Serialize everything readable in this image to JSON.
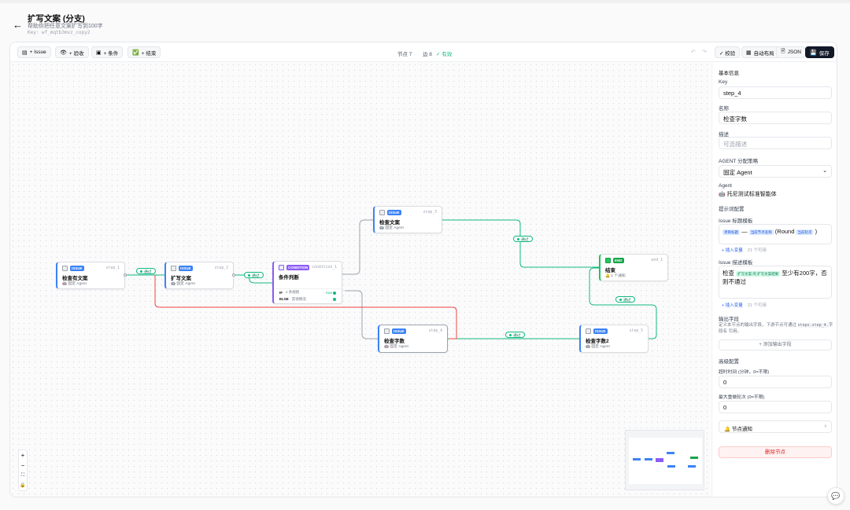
{
  "header": {
    "back_icon": "arrow-left-icon",
    "title": "扩写文案 (分支)",
    "subtitle": "帮助你把任意文案扩写到100字",
    "key_line": "Key: wf_mqtb3mvz_copy2"
  },
  "toolbar": {
    "add_issue": "+ Issue",
    "add_review": "+ 验收",
    "add_condition": "+ 条件",
    "add_end": "+ 结束",
    "node_count": "节点 7",
    "edge_count": "边 8",
    "valid": "✓ 有效",
    "validate": "✓ 校验",
    "auto_layout": "自动布局",
    "json": "JSON",
    "save": "保存"
  },
  "nodes": {
    "step1": {
      "badge": "ISSUE",
      "key": "step_1",
      "title": "检查有文案",
      "agent": "固定 Agent"
    },
    "step2": {
      "badge": "ISSUE",
      "key": "step_2",
      "title": "扩写文案",
      "agent": "固定 Agent"
    },
    "cond": {
      "badge": "CONDITION",
      "key": "condition_1",
      "title": "条件判断",
      "if_label": "IF",
      "if_text": "1 条规则",
      "if_val": "true",
      "else_label": "ELSE",
      "else_text": "其他情况"
    },
    "step3": {
      "badge": "ISSUE",
      "key": "step_3",
      "title": "检查文案",
      "agent": "固定 Agent"
    },
    "step4": {
      "badge": "ISSUE",
      "key": "step_4",
      "title": "检查字数",
      "agent": "固定 Agent"
    },
    "step5": {
      "badge": "ISSUE",
      "key": "step_5",
      "title": "检查字数2",
      "agent": "固定 Agent"
    },
    "end": {
      "badge": "END",
      "key": "end_1",
      "title": "结束",
      "sub": "1 个通知"
    }
  },
  "edge_label": "通过",
  "zoom": {
    "in": "+",
    "out": "−",
    "fit": "⛶",
    "lock": "🔒"
  },
  "panel": {
    "basic_info": "基本信息",
    "key_label": "Key",
    "key_value": "step_4",
    "name_label": "名称",
    "name_value": "检查字数",
    "desc_label": "描述",
    "desc_placeholder": "可选描述",
    "agent_strategy_label": "AGENT 分配策略",
    "agent_strategy_value": "固定 Agent",
    "agent_label": "Agent",
    "agent_value": "托尼测试标准智能体",
    "prompt_config": "提示词配置",
    "issue_title_tmpl_label": "Issue 标题模板",
    "chip_project_title": "项目标题",
    "title_sep": "—",
    "chip_node_name": "当前节点名称",
    "title_round_open": "(Round",
    "chip_round": "当前轮次",
    "title_round_close": ")",
    "insert_var": "+ 插入变量",
    "var_count": "21 个可用",
    "issue_desc_tmpl_label": "Issue 描述模板",
    "desc_prefix": "检查",
    "chip_expand_result": "扩写文案 的 扩写文案结果",
    "desc_suffix": "至少有200字，否则不通过",
    "output_fields": "输出字段",
    "output_hint_a": "定义本节点的输出字段，下游节点可通过",
    "output_hint_code": "steps.step_4.",
    "output_hint_b": "字段名 引用。",
    "add_output": "+ 添加输出字段",
    "advanced": "高级配置",
    "timeout_label": "超时时间 (分钟，0=不限)",
    "timeout_value": "0",
    "max_rounds_label": "最大重做轮次 (0=不限)",
    "max_rounds_value": "0",
    "node_notify": "节点通知",
    "delete_node": "删除节点"
  },
  "colors": {
    "accent": "#3b82f6",
    "condition": "#8b5cf6",
    "end": "#16a34a",
    "pass_edge": "#10b981",
    "fail_edge": "#ef4444",
    "save_bg": "#111827"
  }
}
